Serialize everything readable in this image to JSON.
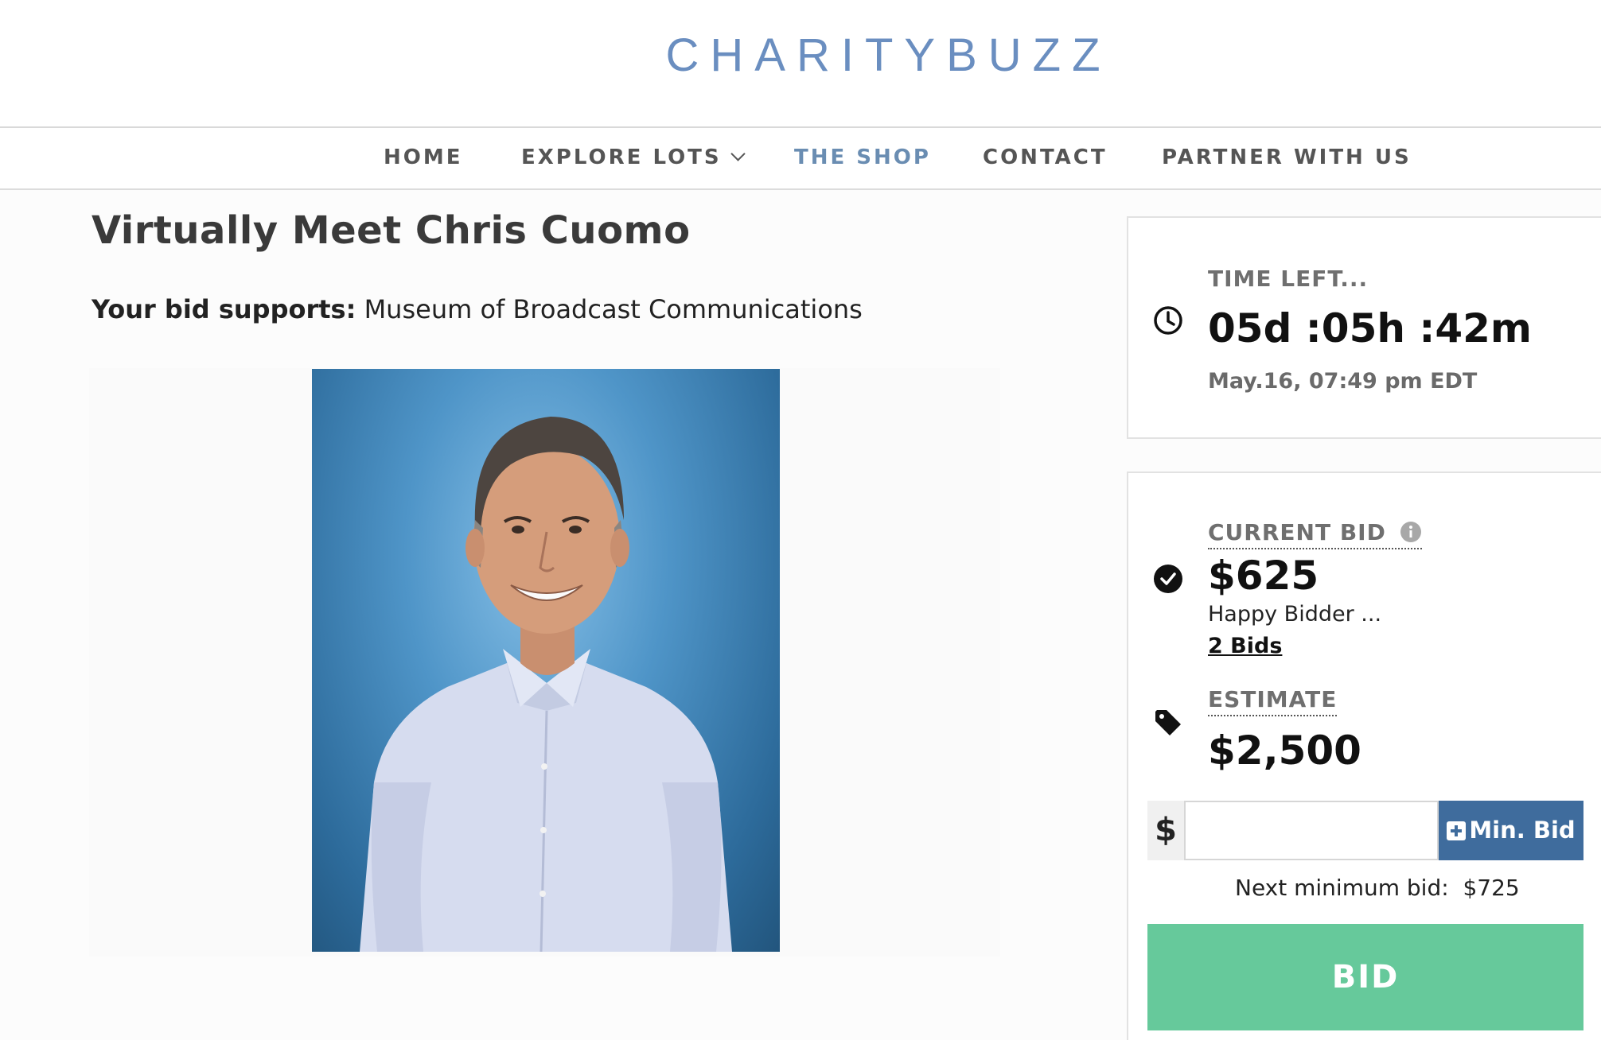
{
  "header": {
    "logo": "CHARITYBUZZ"
  },
  "nav": {
    "items": [
      {
        "label": "HOME"
      },
      {
        "label": "EXPLORE LOTS"
      },
      {
        "label": "THE SHOP"
      },
      {
        "label": "CONTACT"
      },
      {
        "label": "PARTNER WITH US"
      }
    ]
  },
  "lot": {
    "title": "Virtually Meet Chris Cuomo",
    "supports_label": "Your bid supports:",
    "supports_value": "Museum of Broadcast Communications"
  },
  "timer": {
    "label": "TIME LEFT...",
    "countdown": "05d :05h :42m",
    "end": "May.16, 07:49 pm EDT"
  },
  "bid": {
    "current_label": "CURRENT BID",
    "current_value": "$625",
    "bidder": "Happy Bidder ...",
    "bids_link": "2 Bids",
    "estimate_label": "ESTIMATE",
    "estimate_value": "$2,500",
    "currency_symbol": "$",
    "input_value": "",
    "min_bid_button": "Min. Bid",
    "next_min_label": "Next minimum bid:",
    "next_min_value": "$725",
    "bid_button": "BID"
  },
  "colors": {
    "logo": "#6a8ec0",
    "nav_active": "#6a8db2",
    "min_bid_button": "#3f6c9d",
    "bid_button": "#66c99b"
  }
}
